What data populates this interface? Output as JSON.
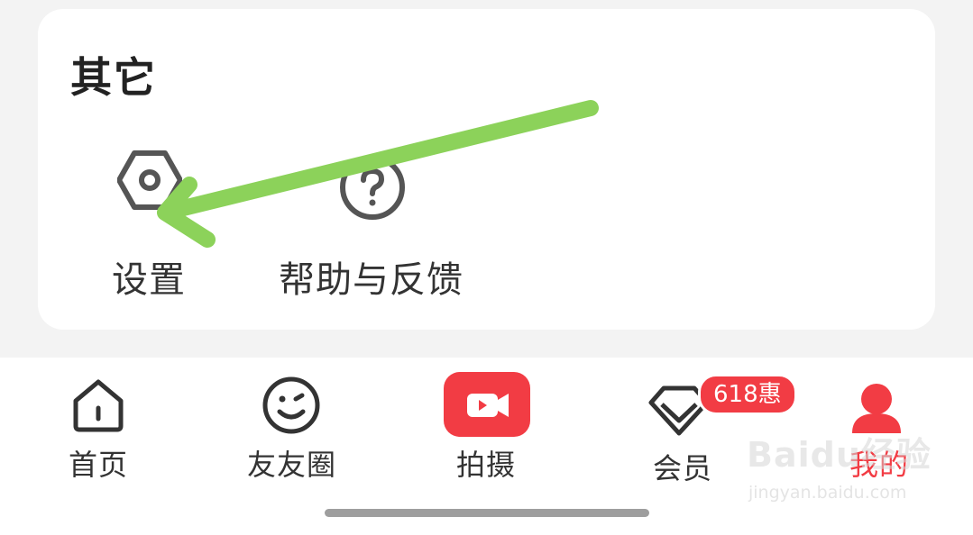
{
  "section": {
    "title": "其它",
    "items": [
      {
        "label": "设置",
        "icon": "settings-hexagon-icon"
      },
      {
        "label": "帮助与反馈",
        "icon": "help-question-icon"
      }
    ]
  },
  "annotation": {
    "type": "arrow",
    "color": "#8cd25a",
    "points_to": "设置"
  },
  "tabbar": {
    "tabs": [
      {
        "label": "首页",
        "icon": "home-icon",
        "active": false
      },
      {
        "label": "友友圈",
        "icon": "smiley-face-icon",
        "active": false
      },
      {
        "label": "拍摄",
        "icon": "video-camera-icon",
        "active": false
      },
      {
        "label": "会员",
        "icon": "diamond-icon",
        "active": false,
        "badge": "618惠"
      },
      {
        "label": "我的",
        "icon": "user-profile-icon",
        "active": true
      }
    ],
    "active_color": "#f23c44"
  },
  "watermark": {
    "brand": "Baidu经验",
    "url": "jingyan.baidu.com"
  }
}
